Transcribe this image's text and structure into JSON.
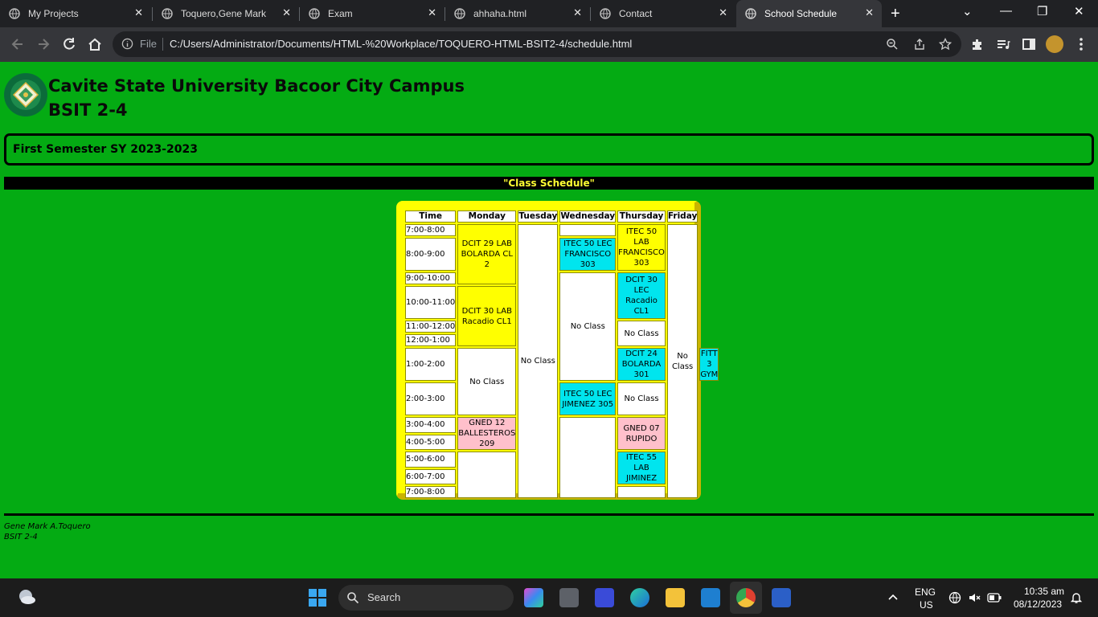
{
  "browser": {
    "tabs": [
      {
        "label": "My Projects"
      },
      {
        "label": "Toquero,Gene Mark"
      },
      {
        "label": "Exam"
      },
      {
        "label": "ahhaha.html"
      },
      {
        "label": "Contact"
      },
      {
        "label": "School Schedule"
      }
    ],
    "active_tab": "School Schedule",
    "omnibox": {
      "scheme_label": "File",
      "url": "C:/Users/Administrator/Documents/HTML-%20Workplace/TOQUERO-HTML-BSIT2-4/schedule.html"
    }
  },
  "page": {
    "university": "Cavite State University Bacoor City Campus",
    "section": "BSIT 2-4",
    "semester": "First Semester SY 2023-2023",
    "schedule_heading": "\"Class Schedule\"",
    "table": {
      "headers": [
        "Time",
        "Monday",
        "Tuesday",
        "Wednesday",
        "Thursday",
        "Friday"
      ],
      "times": [
        "7:00-8:00",
        "8:00-9:00",
        "9:00-10:00",
        "10:00-11:00",
        "11:00-12:00",
        "12:00-1:00",
        "1:00-2:00",
        "2:00-3:00",
        "3:00-4:00",
        "4:00-5:00",
        "5:00-6:00",
        "6:00-7:00",
        "7:00-8:00"
      ],
      "monday": [
        "DCIT 29 LAB BOLARDA CL 2",
        "DCIT 30 LAB Racadio CL1",
        "No Class",
        "GNED 12 BALLESTEROS 209",
        ""
      ],
      "tuesday": [
        "No Class"
      ],
      "wednesday": [
        "",
        "ITEC 50 LEC FRANCISCO 303",
        "No Class",
        "DCIT 24 BOLARDA 301",
        "ITEC 50 LEC JIMENEZ 305",
        ""
      ],
      "thursday": [
        "ITEC 50 LAB FRANCISCO 303",
        "DCIT 30 LEC Racadio CL1",
        "No Class",
        "FITT 3 GYM",
        "No Class",
        "GNED 07 RUPIDO",
        "ITEC 55 LAB JIMINEZ",
        ""
      ],
      "friday": [
        "No Class"
      ]
    },
    "footer": {
      "name": "Gene Mark A.Toquero",
      "section": "BSIT 2-4"
    }
  },
  "taskbar": {
    "search_label": "Search",
    "language": "ENG",
    "region": "US",
    "time": "10:35 am",
    "date": "08/12/2023"
  },
  "colors": {
    "page_background": "#04ab13",
    "yellow_cell": "#ffff00",
    "cyan_cell": "#00e5ee",
    "pink_cell": "#ffc0cb",
    "heading_text": "#ffff33"
  }
}
